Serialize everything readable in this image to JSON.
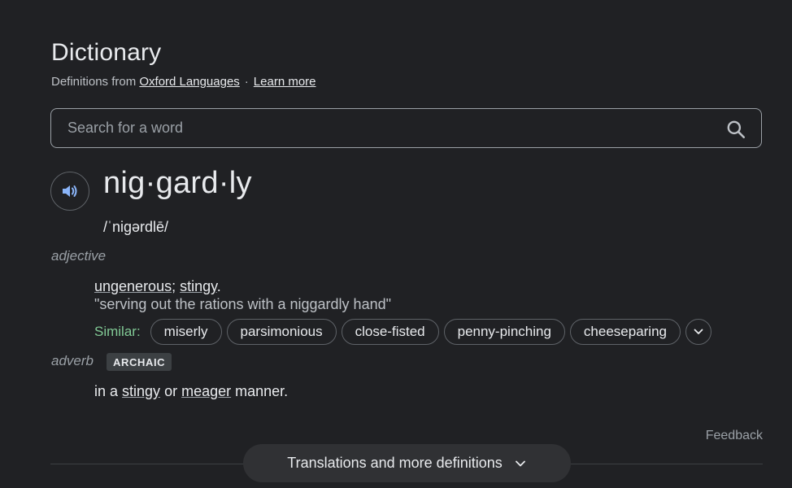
{
  "header": {
    "title": "Dictionary",
    "source_prefix": "Definitions from",
    "source_link": "Oxford Languages",
    "separator": "·",
    "learn_more": "Learn more"
  },
  "search": {
    "placeholder": "Search for a word",
    "icon": "search-icon"
  },
  "entry": {
    "audio_icon": "speaker-icon",
    "headword": "nig·gard·ly",
    "phonetic": "/ˈniɡərdlē/"
  },
  "senses": [
    {
      "part_of_speech": "adjective",
      "definition_parts": [
        "ungenerous",
        "; ",
        "stingy",
        "."
      ],
      "example": "\"serving out the rations with a niggardly hand\"",
      "similar_label": "Similar:",
      "similar": [
        "miserly",
        "parsimonious",
        "close-fisted",
        "penny-pinching",
        "cheeseparing"
      ]
    },
    {
      "part_of_speech": "adverb",
      "label": "ARCHAIC",
      "definition_parts": [
        "in a ",
        "stingy",
        " or ",
        "meager",
        " manner."
      ]
    }
  ],
  "footer": {
    "feedback": "Feedback",
    "more_button": "Translations and more definitions"
  },
  "colors": {
    "background": "#202124",
    "similar_label": "#81c995",
    "speaker_icon": "#8ab4f8"
  }
}
